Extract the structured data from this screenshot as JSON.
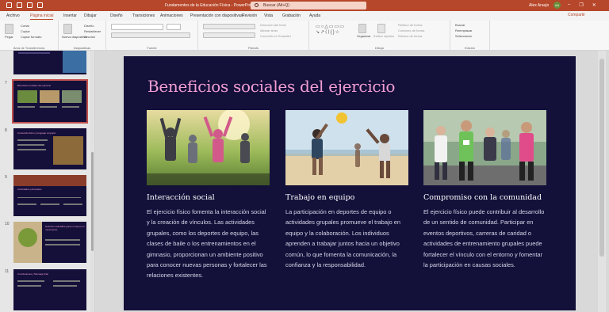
{
  "titlebar": {
    "doc_title": "Fundamentos de la Educación Física  -  PowerPoint",
    "search_placeholder": "Buscar (Alt+Q)",
    "user_name": "Alex Araujo",
    "user_initials": "AA",
    "min": "–",
    "max": "❐",
    "close": "✕"
  },
  "tabs": [
    "Archivo",
    "Página inicial",
    "Insertar",
    "Dibujar",
    "Diseño",
    "Transiciones",
    "Animaciones",
    "Presentación con diapositivas",
    "Revisión",
    "Vista",
    "Grabación",
    "Ayuda"
  ],
  "active_tab": "Página inicial",
  "share_label": "Compartir",
  "ribbon": {
    "clipboard": {
      "paste": "Pegar",
      "cut": "Cortar",
      "copy": "Copiar",
      "format_painter": "Copiar formato",
      "label": "Área de Transferencia"
    },
    "slides": {
      "new_slide": "Nueva diapositiva",
      "layout": "Diseño",
      "reset": "Restablecer",
      "section": "Sección",
      "label": "Diapositivas"
    },
    "font": {
      "label": "Fuente"
    },
    "paragraph": {
      "text_direction": "Dirección del texto",
      "align_text": "Alinear texto",
      "smartart": "Convertir en SmartArt",
      "label": "Párrafo"
    },
    "drawing": {
      "arrange": "Organizar",
      "quick_styles": "Estilos rápidos",
      "fill": "Relleno de forma",
      "outline": "Contorno de forma",
      "effects": "Efectos de forma",
      "label": "Dibujo"
    },
    "editing": {
      "find": "Buscar",
      "replace": "Reemplazar",
      "select": "Seleccionar",
      "label": "Edición"
    }
  },
  "thumbnails": [
    {
      "num": "",
      "title": ""
    },
    {
      "num": "7",
      "title": "Beneficios sociales del ejercicio"
    },
    {
      "num": "8",
      "title": "Contenido físico y lenguaje corporal"
    },
    {
      "num": "9",
      "title": "Actividades principales"
    },
    {
      "num": "10",
      "title": "Nutrición saludable para el cuerpo en movimiento"
    },
    {
      "num": "11",
      "title": "Conclusiones y Mensaje final"
    }
  ],
  "slide": {
    "title": "Beneficios sociales del ejercicio",
    "columns": [
      {
        "heading": "Interacción social",
        "body": "El ejercicio físico fomenta la interacción social y la creación de vínculos. Las actividades grupales, como los deportes de equipo, las clases de baile o los entrenamientos en el gimnasio, proporcionan un ambiente positivo para conocer nuevas personas y fortalecer las relaciones existentes."
      },
      {
        "heading": "Trabajo en equipo",
        "body": "La participación en deportes de equipo o actividades grupales promueve el trabajo en equipo y la colaboración. Los individuos aprenden a trabajar juntos hacia un objetivo común, lo que fomenta la comunicación, la confianza y la responsabilidad."
      },
      {
        "heading": "Compromiso con la comunidad",
        "body": "El ejercicio físico puede contribuir al desarrollo de un sentido de comunidad. Participar en eventos deportivos, carreras de caridad o actividades de entrenamiento grupales puede fortalecer el vínculo con el entorno y fomentar la participación en causas sociales."
      }
    ]
  },
  "colors": {
    "accent": "#b7472a",
    "slide_bg": "#13103a",
    "title_pink": "#f19ed2"
  }
}
